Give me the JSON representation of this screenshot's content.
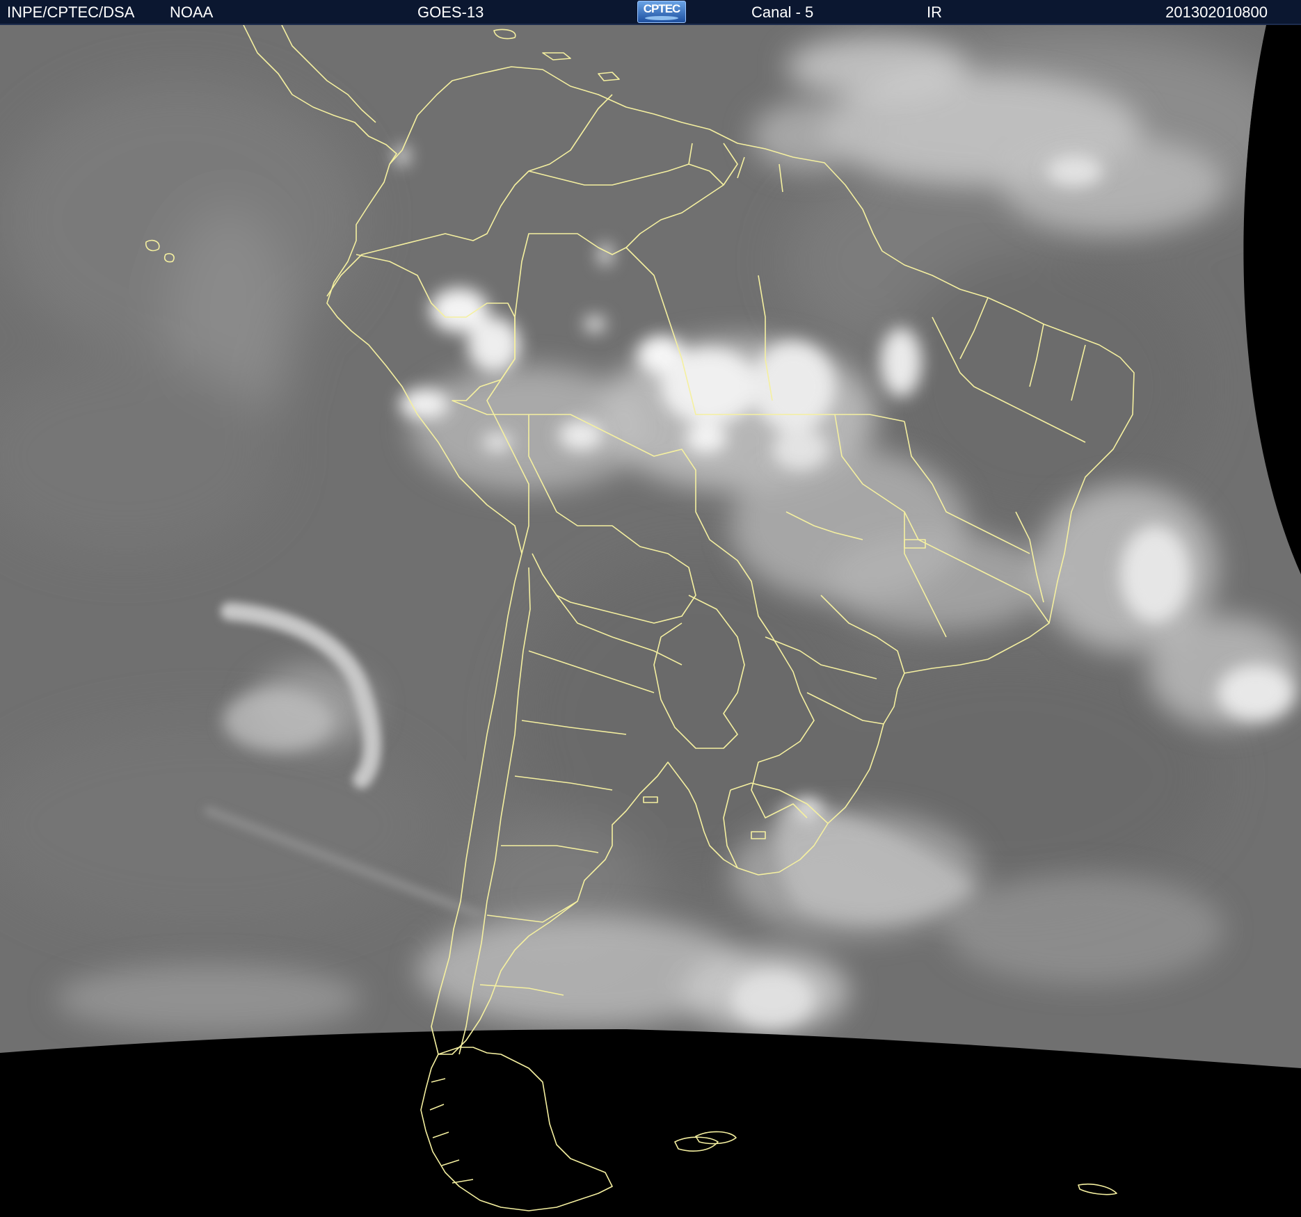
{
  "header": {
    "organization": "INPE/CPTEC/DSA",
    "source": "NOAA",
    "satellite": "GOES-13",
    "logo_text": "CPTEC",
    "channel": "Canal - 5",
    "band": "IR",
    "timestamp": "201302010800"
  },
  "map": {
    "colors": {
      "header_background": "#0b1730",
      "space": "#000000",
      "earth_gray": "#6f6f6f",
      "cloud": "#f2f2f2",
      "borders": "#f5f0a0"
    }
  }
}
